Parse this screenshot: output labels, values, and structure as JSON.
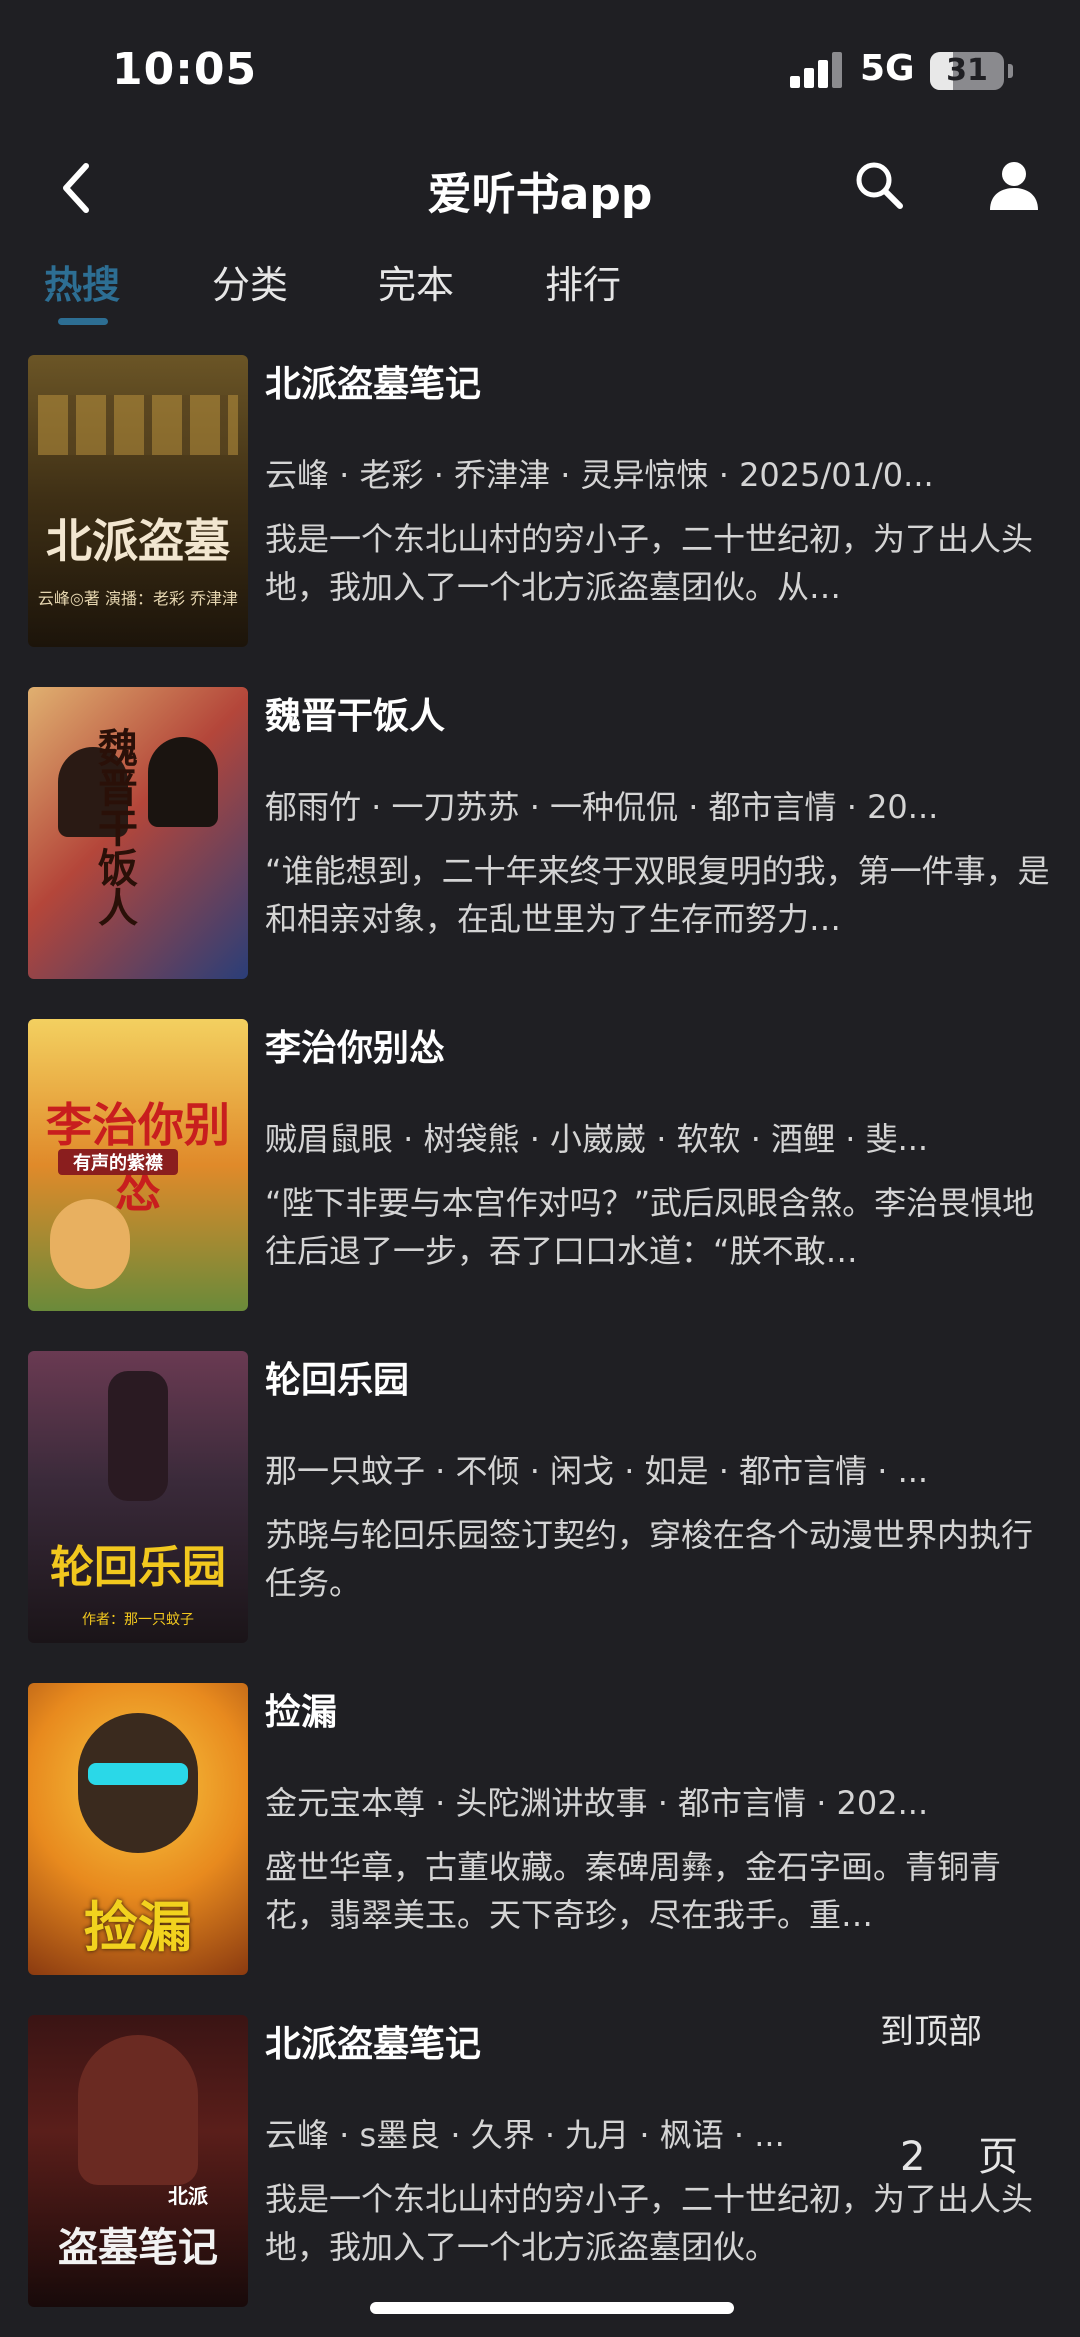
{
  "status_bar": {
    "time": "10:05",
    "network": "5G",
    "battery_level": "31",
    "battery_fraction": 0.31
  },
  "nav": {
    "title": "爱听书app",
    "back_icon": "chevron-left-icon",
    "search_icon": "search-icon",
    "user_icon": "user-icon"
  },
  "tabs": [
    {
      "label": "热搜",
      "active": true
    },
    {
      "label": "分类",
      "active": false
    },
    {
      "label": "完本",
      "active": false
    },
    {
      "label": "排行",
      "active": false
    }
  ],
  "accent_color": "#2d6e93",
  "books": [
    {
      "title": "北派盗墓笔记",
      "meta": "云峰 · 老彩 · 乔津津 · 灵异惊悚 · 2025/01/0...",
      "desc": "我是一个东北山村的穷小子，二十世纪初，为了出人头地，我加入了一个北方派盗墓团伙。从…",
      "cover_text": "北派盗墓",
      "cover_subtext": "云峰◎著 演播：老彩 乔津津",
      "cover_bg": "#4a3a1e"
    },
    {
      "title": "魏晋干饭人",
      "meta": "郁雨竹 · 一刀苏苏 · 一种侃侃 · 都市言情 · 20...",
      "desc": "“谁能想到，二十年来终于双眼复明的我，第一件事，是和相亲对象，在乱世里为了生存而努力…",
      "cover_text": "魏晋干饭人",
      "cover_subtext": "",
      "cover_bg": "#c8894a"
    },
    {
      "title": "李治你别怂",
      "meta": "贼眉鼠眼 · 树袋熊 · 小崴崴 · 软软 · 酒鲤 · 斐...",
      "desc": "“陛下非要与本宫作对吗？”武后凤眼含煞。李治畏惧地往后退了一步，吞了口口水道：“朕不敢…",
      "cover_text": "李治你别怂",
      "cover_subtext": "有声的紫襟",
      "cover_bg": "#e0a030"
    },
    {
      "title": "轮回乐园",
      "meta": "那一只蚊子 · 不倾 · 闲戈 · 如是 · 都市言情 · ...",
      "desc": "苏晓与轮回乐园签订契约，穿梭在各个动漫世界内执行任务。",
      "cover_text": "轮回乐园",
      "cover_subtext": "作者：那一只蚊子",
      "cover_bg": "#4a3040"
    },
    {
      "title": "捡漏",
      "meta": "金元宝本尊 · 头陀渊讲故事 · 都市言情 · 202...",
      "desc": "盛世华章，古董收藏。秦碑周彝，金石字画。青铜青花，翡翠美玉。天下奇珍，尽在我手。重…",
      "cover_text": "捡漏",
      "cover_subtext": "",
      "cover_bg": "#e8a020"
    },
    {
      "title": "北派盗墓笔记",
      "meta": "云峰 · s墨良 · 久界 · 九月 · 枫语 · ...",
      "desc": "我是一个东北山村的穷小子，二十世纪初，为了出人头地，我加入了一个北方派盗墓团伙。",
      "cover_text": "盗墓笔记",
      "cover_subtext": "北派",
      "cover_bg": "#3a1a1a"
    }
  ],
  "floating": {
    "to_top": "到顶部",
    "page_number": "2",
    "page_unit": "页"
  }
}
